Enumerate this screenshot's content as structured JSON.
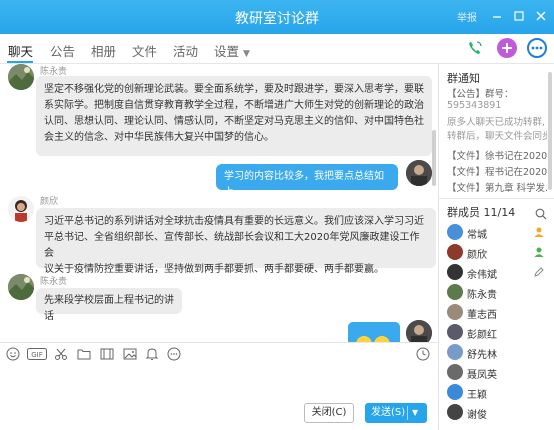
{
  "window": {
    "title": "教研室讨论群",
    "report_label": "举报",
    "controls": [
      "minimize",
      "maximize",
      "close"
    ]
  },
  "tabs": [
    {
      "label": "聊天",
      "active": true
    },
    {
      "label": "公告",
      "active": false
    },
    {
      "label": "相册",
      "active": false
    },
    {
      "label": "文件",
      "active": false
    },
    {
      "label": "活动",
      "active": false
    },
    {
      "label": "设置",
      "active": false
    }
  ],
  "toolbar_icons": [
    "phone-call-icon",
    "add-app-icon",
    "more-icon"
  ],
  "messages": [
    {
      "sender": "陈永贵",
      "side": "left",
      "text_lines": [
        "坚定不移强化党的创新理论武装。要全面系统学，要及时跟进学，要深入思考学，要联",
        "系实际学。把制度自信贯穿教育教学全过程，不断增进广大师生对党的创新理论的政治",
        "认同、思想认同、理论认同、情感认同，不断坚定对马克思主义的信仰、对中国特色社",
        "会主义的信念、对中华民族伟大复兴中国梦的信心。"
      ]
    },
    {
      "sender": "",
      "side": "right",
      "text_lines": [
        "学习的内容比较多，我把要点总结如上。"
      ]
    },
    {
      "sender": "颜欣",
      "side": "left",
      "text_lines": [
        "习近平总书记的系列讲话对全球抗击疫情具有重要的长远意义。我们应该深入学习习近",
        "平总书记、全省组织部长、宣传部长、统战部长会议和工大2020年党风廉政建设工作会",
        "议关于疫情防控重要讲话，坚持做到两手都要抓、两手都要硬、两手都要赢。"
      ]
    },
    {
      "sender": "陈永贵",
      "side": "left",
      "text_lines": [
        "先来段学校层面上程书记的讲话"
      ]
    },
    {
      "sender": "",
      "side": "right",
      "text_lines": [],
      "is_image": true
    }
  ],
  "editor": {
    "icons": [
      "emoji-icon",
      "gif-icon",
      "scissors-icon",
      "folder-icon",
      "gallery-icon",
      "image-icon",
      "bell-icon",
      "more-icon",
      "history-clock-icon"
    ],
    "gif_label": "GIF",
    "close_label": "关闭(C)",
    "send_label": "发送(S)"
  },
  "sidebar": {
    "notice_title": "群通知",
    "notice_lines": [
      "【公告】群号：",
      "595343891",
      "原多人聊天已成功转群,",
      "转群后，聊天文件会同步",
      "【文件】徐书记在2020...",
      "【文件】程书记在2020...",
      "【文件】第九章 科学发..."
    ],
    "members_title": "群成员 11/14",
    "members": [
      {
        "name": "常城",
        "badge": "owner"
      },
      {
        "name": "颜欣",
        "badge": "admin"
      },
      {
        "name": "余伟斌",
        "badge": "edit"
      },
      {
        "name": "陈永贵",
        "badge": ""
      },
      {
        "name": "董志西",
        "badge": ""
      },
      {
        "name": "彭颜红",
        "badge": ""
      },
      {
        "name": "舒先林",
        "badge": ""
      },
      {
        "name": "聂凤英",
        "badge": ""
      },
      {
        "name": "王颖",
        "badge": ""
      },
      {
        "name": "谢俊",
        "badge": ""
      }
    ]
  }
}
